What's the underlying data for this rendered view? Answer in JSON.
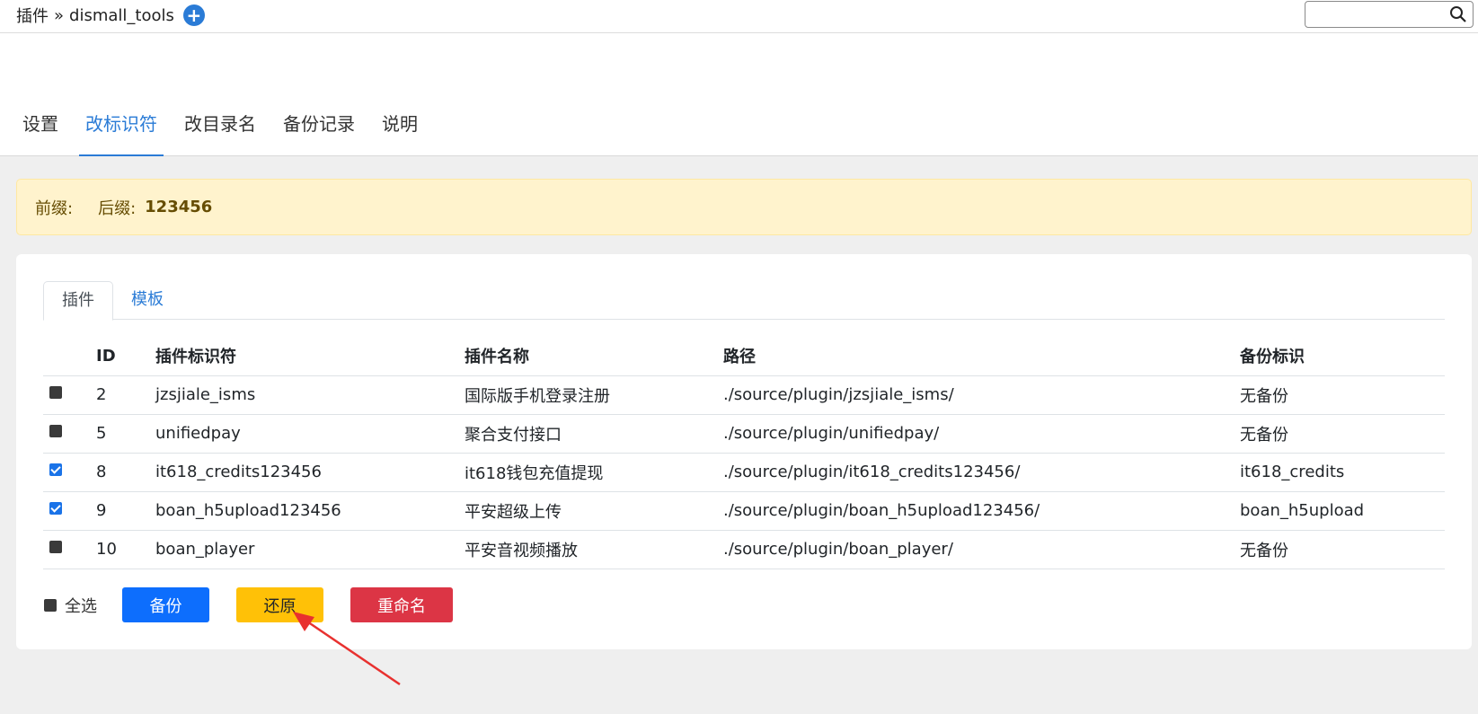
{
  "header": {
    "breadcrumb_root": "插件",
    "breadcrumb_sep": "»",
    "breadcrumb_current": "dismall_tools",
    "search": {
      "value": "",
      "placeholder": ""
    }
  },
  "nav": {
    "tabs": [
      {
        "label": "设置",
        "active": false
      },
      {
        "label": "改标识符",
        "active": true
      },
      {
        "label": "改目录名",
        "active": false
      },
      {
        "label": "备份记录",
        "active": false
      },
      {
        "label": "说明",
        "active": false
      }
    ]
  },
  "alert": {
    "prefix_label": "前缀:",
    "prefix_value": "",
    "suffix_label": "后缀:",
    "suffix_value": "123456"
  },
  "subtabs": [
    {
      "label": "插件",
      "active": true
    },
    {
      "label": "模板",
      "active": false
    }
  ],
  "table": {
    "headers": [
      "ID",
      "插件标识符",
      "插件名称",
      "路径",
      "备份标识"
    ],
    "rows": [
      {
        "checked": false,
        "id": "2",
        "identifier": "jzsjiale_isms",
        "name": "国际版手机登录注册",
        "path": "./source/plugin/jzsjiale_isms/",
        "backup": "无备份",
        "has_backup": false
      },
      {
        "checked": false,
        "id": "5",
        "identifier": "unifiedpay",
        "name": "聚合支付接口",
        "path": "./source/plugin/unifiedpay/",
        "backup": "无备份",
        "has_backup": false
      },
      {
        "checked": true,
        "id": "8",
        "identifier": "it618_credits123456",
        "name": "it618钱包充值提现",
        "path": "./source/plugin/it618_credits123456/",
        "backup": "it618_credits",
        "has_backup": true
      },
      {
        "checked": true,
        "id": "9",
        "identifier": "boan_h5upload123456",
        "name": "平安超级上传",
        "path": "./source/plugin/boan_h5upload123456/",
        "backup": "boan_h5upload",
        "has_backup": true
      },
      {
        "checked": false,
        "id": "10",
        "identifier": "boan_player",
        "name": "平安音视频播放",
        "path": "./source/plugin/boan_player/",
        "backup": "无备份",
        "has_backup": false
      }
    ]
  },
  "footer": {
    "select_all_label": "全选",
    "backup_label": "备份",
    "restore_label": "还原",
    "rename_label": "重命名"
  },
  "colors": {
    "accent": "#2a7bd6",
    "no_backup": "#dc3545",
    "has_backup": "#198754",
    "btn_backup": "#0d6efd",
    "btn_restore": "#ffc107",
    "btn_rename": "#dc3545",
    "annotation_arrow": "#e8312f"
  },
  "icons": [
    "plus-circle-icon",
    "search-icon",
    "annotation-arrow-icon"
  ]
}
